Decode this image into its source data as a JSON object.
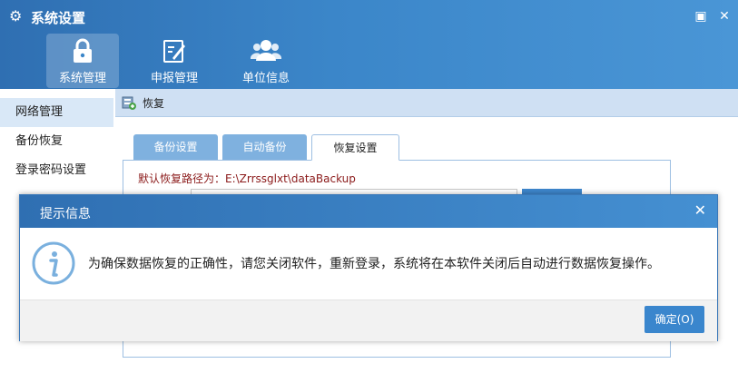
{
  "window": {
    "title": "系统设置",
    "controls": {
      "restore_icon": "restore-icon",
      "close_icon": "close-icon"
    }
  },
  "nav": {
    "tabs": [
      {
        "label": "系统管理",
        "icon": "lock-icon",
        "active": true
      },
      {
        "label": "申报管理",
        "icon": "edit-icon",
        "active": false
      },
      {
        "label": "单位信息",
        "icon": "users-icon",
        "active": false
      }
    ]
  },
  "sidebar": {
    "items": [
      {
        "label": "网络管理",
        "active": true
      },
      {
        "label": "备份恢复",
        "active": false
      },
      {
        "label": "登录密码设置",
        "active": false
      }
    ]
  },
  "breadcrumb": {
    "label": "恢复",
    "icon": "restore-db-icon"
  },
  "tabs": [
    {
      "label": "备份设置",
      "active": false
    },
    {
      "label": "自动备份",
      "active": false
    },
    {
      "label": "恢复设置",
      "active": true
    }
  ],
  "restore": {
    "default_path_text": "默认恢复路径为：E:\\Zrrssglxt\\dataBackup"
  },
  "dialog": {
    "title": "提示信息",
    "message": "为确保数据恢复的正确性，请您关闭软件，重新登录，系统将在本软件关闭后自动进行数据恢复操作。",
    "ok_label": "确定(O)",
    "icon": "info-icon"
  },
  "colors": {
    "accent": "#3a86cd",
    "header": "#2f6fb2",
    "path_text": "#8b1a1a"
  }
}
